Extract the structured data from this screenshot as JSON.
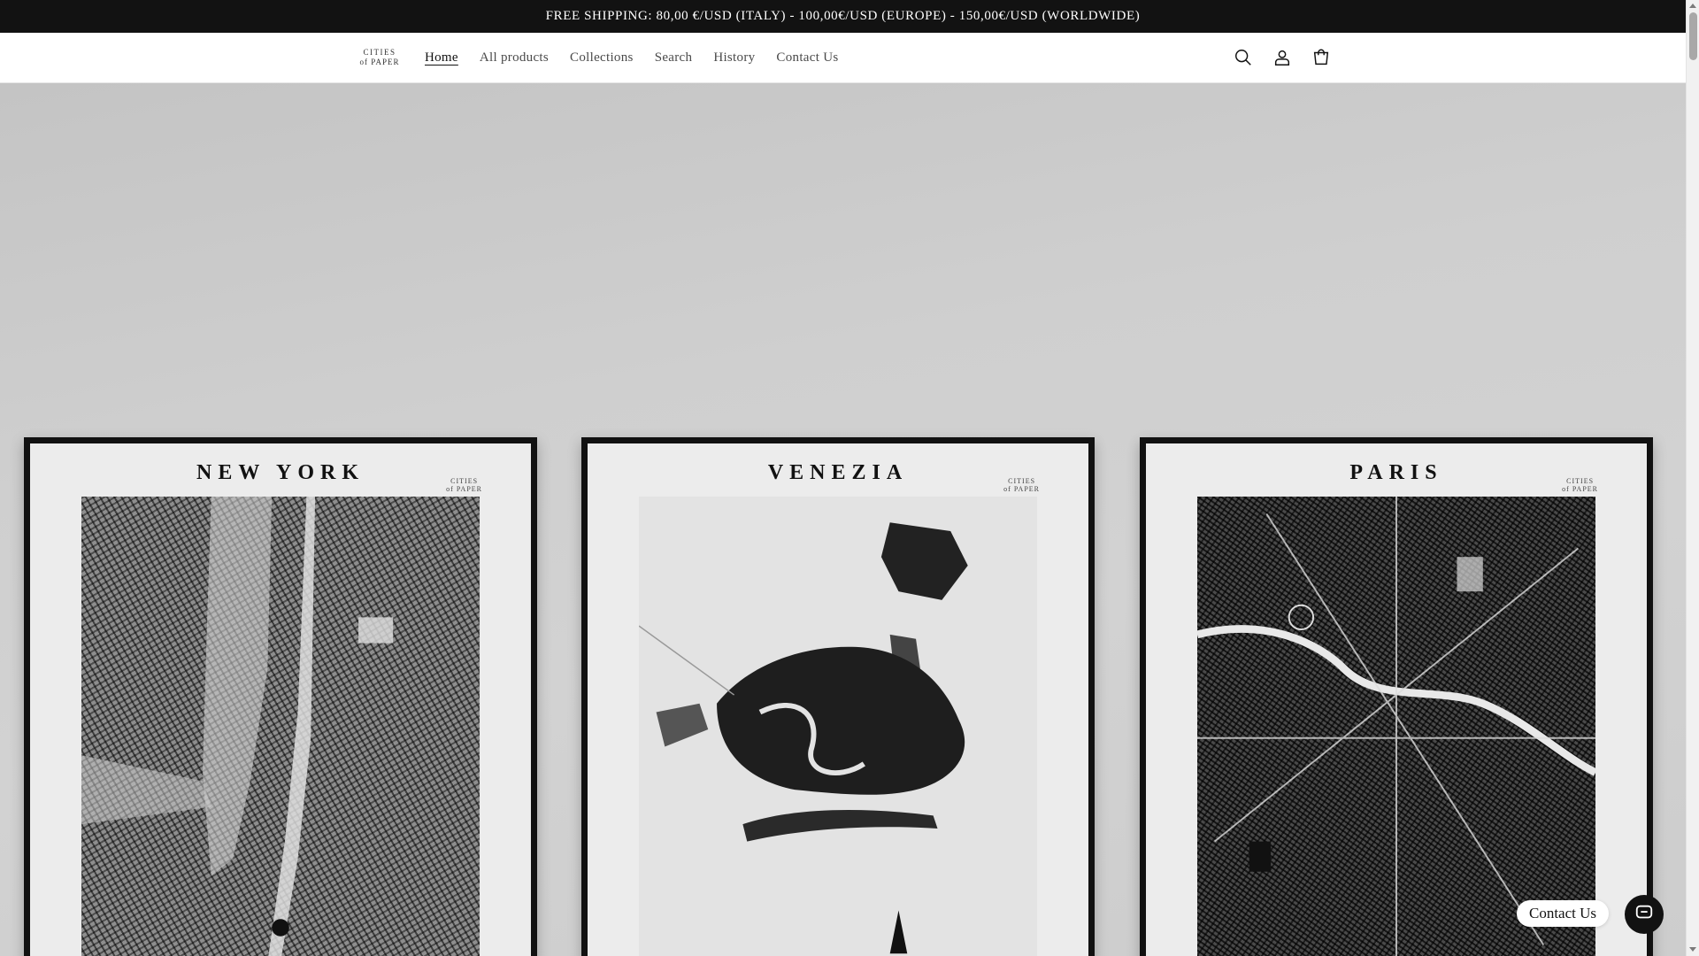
{
  "announcement": {
    "text": "FREE SHIPPING: 80,00 €/USD (ITALY) - 100,00€/USD (EUROPE) - 150,00€/USD (WORLDWIDE)"
  },
  "header": {
    "logo_line1": "CITIES",
    "logo_line2": "of PAPER",
    "nav": [
      {
        "label": "Home",
        "active": true
      },
      {
        "label": "All products",
        "active": false
      },
      {
        "label": "Collections",
        "active": false
      },
      {
        "label": "Search",
        "active": false
      },
      {
        "label": "History",
        "active": false
      },
      {
        "label": "Contact Us",
        "active": false
      }
    ],
    "icons": [
      "search-icon",
      "account-icon",
      "cart-icon"
    ]
  },
  "hero": {
    "posters": [
      {
        "title": "NEW YORK",
        "brand_line1": "CITIES",
        "brand_line2": "of PAPER"
      },
      {
        "title": "VENEZIA",
        "brand_line1": "CITIES",
        "brand_line2": "of PAPER"
      },
      {
        "title": "PARIS",
        "brand_line1": "CITIES",
        "brand_line2": "of PAPER"
      }
    ]
  },
  "contact_widget": {
    "label": "Contact Us",
    "icon": "chat-icon"
  },
  "colors": {
    "announcement_bg": "#121212",
    "text": "#121212",
    "hero_bg": "#cfcfcf"
  }
}
